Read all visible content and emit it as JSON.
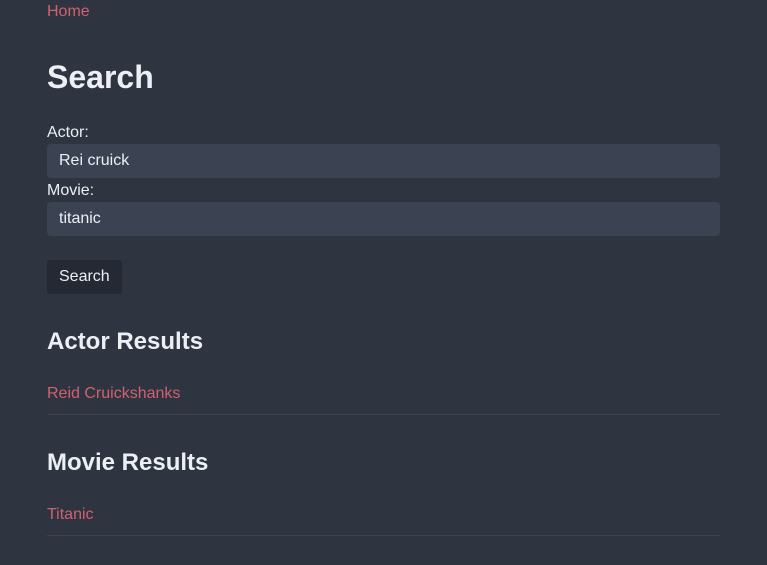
{
  "nav": {
    "home_label": "Home"
  },
  "page": {
    "title": "Search"
  },
  "form": {
    "actor_label": "Actor:",
    "actor_value": "Rei cruick",
    "movie_label": "Movie:",
    "movie_value": "titanic",
    "search_label": "Search"
  },
  "actor_results": {
    "heading": "Actor Results",
    "items": [
      {
        "label": "Reid Cruickshanks"
      }
    ]
  },
  "movie_results": {
    "heading": "Movie Results",
    "items": [
      {
        "label": "Titanic"
      }
    ]
  },
  "colors": {
    "background": "#2e3440",
    "link": "#d0616f",
    "input_bg": "#3b4252",
    "button_bg": "#242933",
    "text": "#eceff4"
  }
}
